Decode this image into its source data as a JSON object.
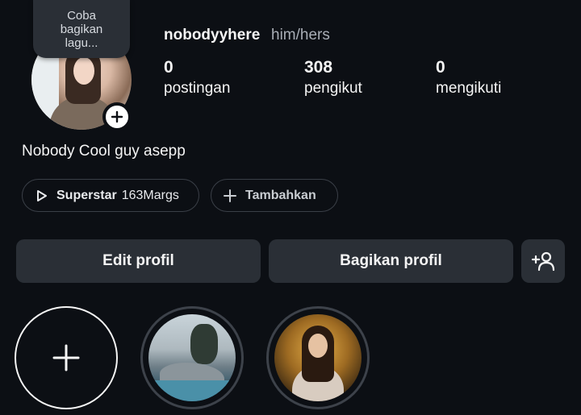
{
  "profile": {
    "note": "Coba bagikan lagu...",
    "username": "nobodyyhere",
    "pronouns": "him/hers",
    "bio": "Nobody Cool guy asepp"
  },
  "stats": [
    {
      "value": "0",
      "label": "postingan"
    },
    {
      "value": "308",
      "label": "pengikut"
    },
    {
      "value": "0",
      "label": "mengikuti"
    }
  ],
  "chips": {
    "music_bold": "Superstar",
    "music_rest": "163Margs",
    "add_label": "Tambahkan"
  },
  "buttons": {
    "edit": "Edit profil",
    "share": "Bagikan profil"
  },
  "icons": {
    "add_badge": "plus-icon",
    "play": "play-icon",
    "plus": "plus-icon",
    "add_person": "add-person-icon",
    "new_highlight": "plus-icon"
  }
}
